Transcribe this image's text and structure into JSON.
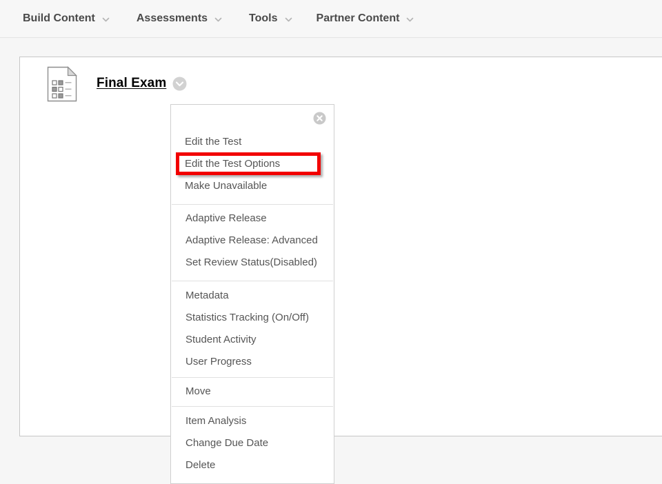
{
  "action_bar": {
    "items": [
      {
        "label": "Build Content",
        "icon": "chevron-down-icon"
      },
      {
        "label": "Assessments",
        "icon": "chevron-down-icon"
      },
      {
        "label": "Tools",
        "icon": "chevron-down-icon"
      },
      {
        "label": "Partner Content",
        "icon": "chevron-down-icon"
      }
    ]
  },
  "content_item": {
    "icon": "test-document-icon",
    "title": "Final Exam",
    "chevron_icon": "chevron-down-circle-icon"
  },
  "context_menu": {
    "close_icon": "close-circle-icon",
    "groups": [
      {
        "items": [
          {
            "label": "Edit the Test",
            "highlighted": false
          },
          {
            "label": "Edit the Test Options",
            "highlighted": true
          },
          {
            "label": "Make Unavailable",
            "highlighted": false
          }
        ]
      },
      {
        "items": [
          {
            "label": "Adaptive Release",
            "highlighted": false
          },
          {
            "label": "Adaptive Release: Advanced",
            "highlighted": false
          },
          {
            "label": "Set Review Status(Disabled)",
            "highlighted": false
          }
        ]
      },
      {
        "items": [
          {
            "label": "Metadata",
            "highlighted": false
          },
          {
            "label": "Statistics Tracking (On/Off)",
            "highlighted": false
          },
          {
            "label": "Student Activity",
            "highlighted": false
          },
          {
            "label": "User Progress",
            "highlighted": false
          }
        ]
      },
      {
        "items": [
          {
            "label": "Move",
            "highlighted": false
          }
        ]
      },
      {
        "items": [
          {
            "label": "Item Analysis",
            "highlighted": false
          },
          {
            "label": "Change Due Date",
            "highlighted": false
          },
          {
            "label": "Delete",
            "highlighted": false
          }
        ]
      }
    ]
  },
  "annotation": {
    "type": "highlight-rectangle",
    "target_label": "Edit the Test Options",
    "color": "#f20000"
  },
  "colors": {
    "page_background": "#f6f6f6",
    "action_bar_background": "#f7f7f7",
    "card_background": "#ffffff",
    "menu_text": "#555555",
    "action_bar_text": "#4a4a4a",
    "highlight": "#f20000"
  }
}
